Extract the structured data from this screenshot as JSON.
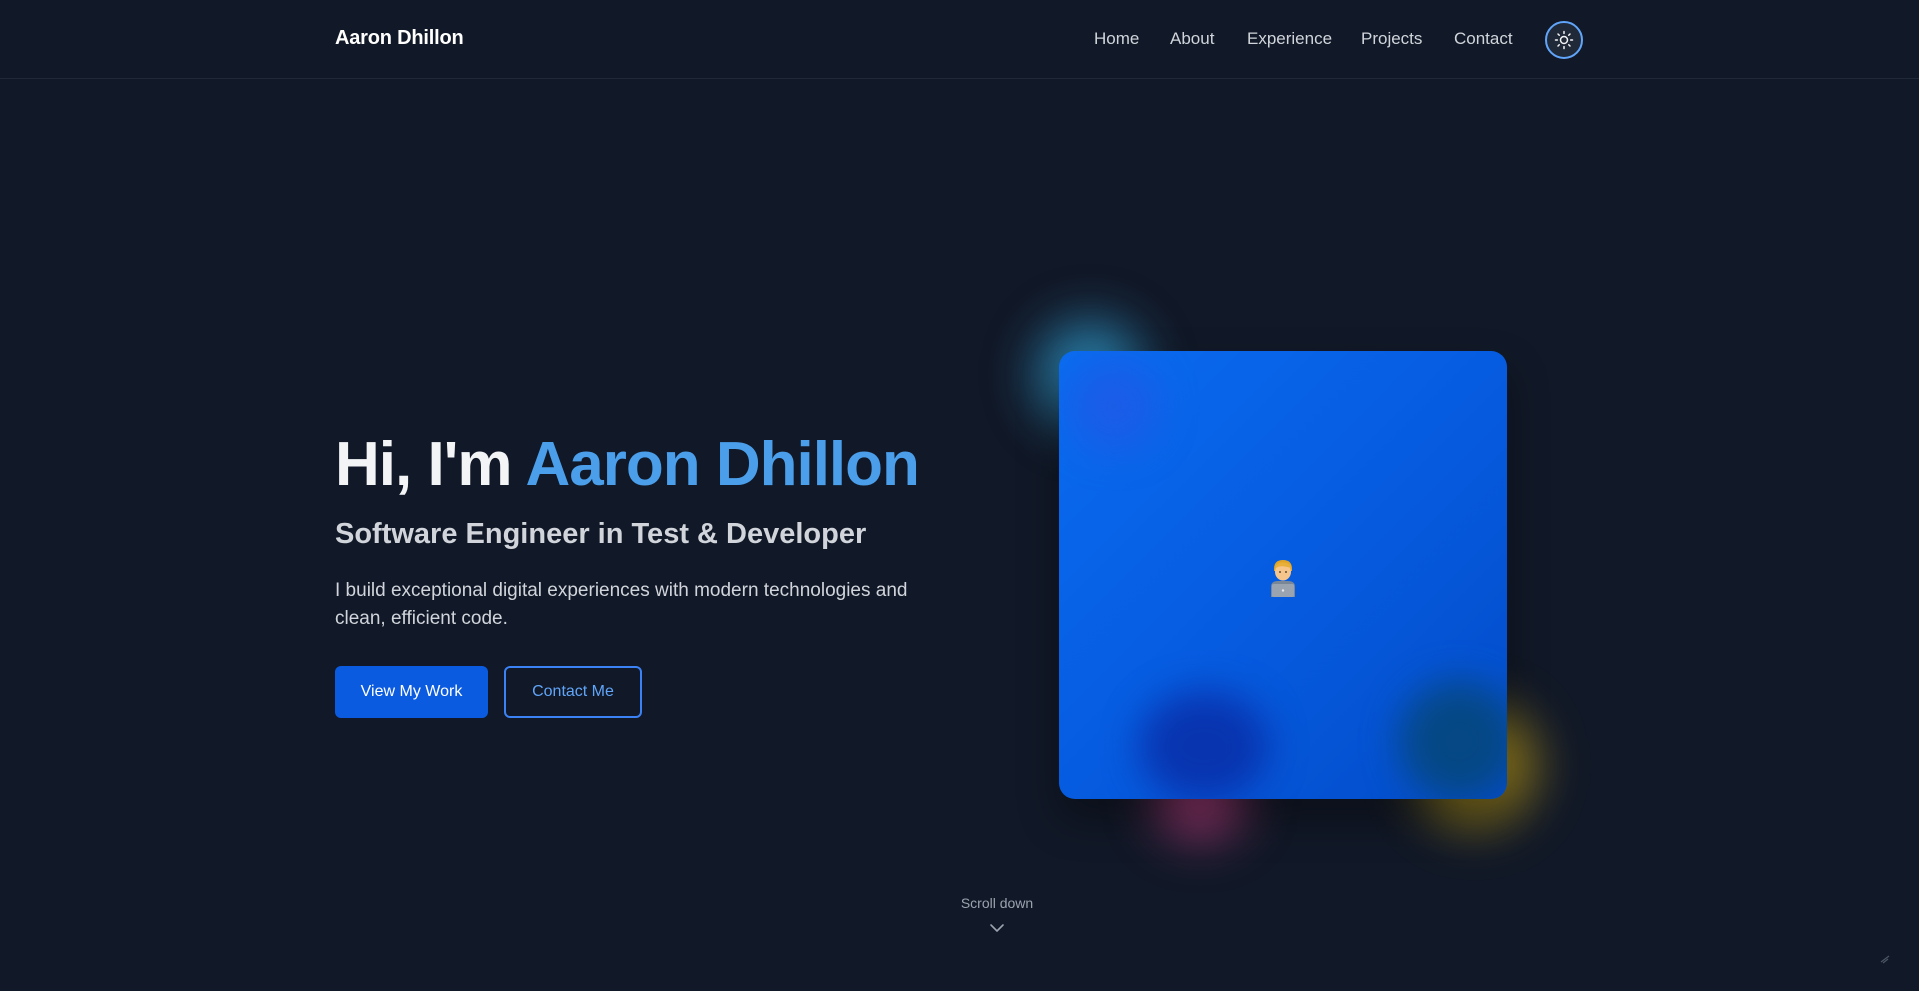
{
  "header": {
    "brand": "Aaron Dhillon",
    "nav": [
      {
        "label": "Home"
      },
      {
        "label": "About"
      },
      {
        "label": "Experience"
      },
      {
        "label": "Projects"
      },
      {
        "label": "Contact"
      }
    ],
    "theme_toggle_icon": "sun-icon"
  },
  "hero": {
    "greeting": "Hi, I'm ",
    "name": "Aaron Dhillon",
    "subtitle": "Software Engineer in Test & Developer",
    "description": "I build exceptional digital experiences with modern technologies and clean, efficient code.",
    "primary_button": "View My Work",
    "secondary_button": "Contact Me",
    "avatar_icon": "technologist-emoji"
  },
  "scroll": {
    "label": "Scroll down",
    "icon": "chevron-down-icon"
  },
  "colors": {
    "background": "#111827",
    "accent": "#4a9eea",
    "primary_button": "#0b5be0",
    "card_gradient_start": "#0a6cf0",
    "card_gradient_end": "#034cc9"
  }
}
